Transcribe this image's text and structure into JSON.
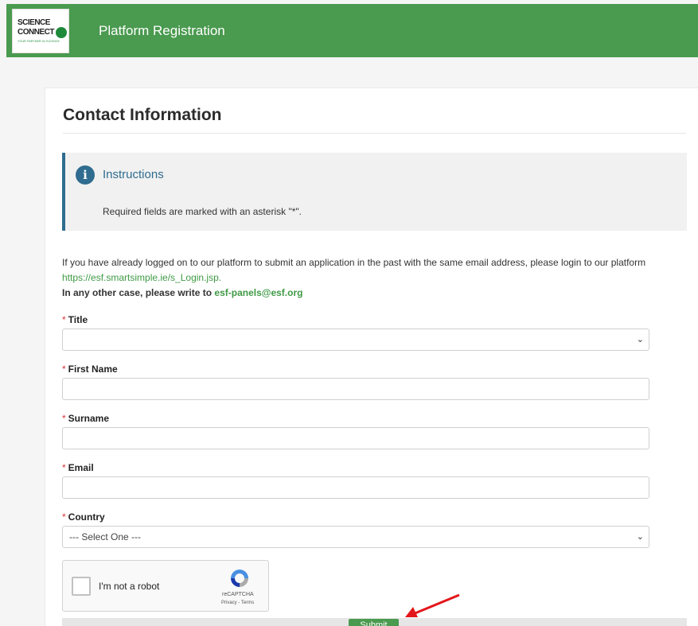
{
  "header": {
    "logo_line1": "SCIENCE",
    "logo_line2": "CONNECT",
    "logo_tagline": "YOUR PARTNER IN SCIENCE",
    "title": "Platform Registration",
    "color": "#4a9a4f"
  },
  "page": {
    "title": "Contact Information"
  },
  "instructions": {
    "icon": "info-icon",
    "title": "Instructions",
    "text": "Required fields are marked with an asterisk \"*\"."
  },
  "intro": {
    "line1": "If you have already logged on to our platform to submit an application in the past with the same email address, please login to our platform",
    "link": "https://esf.smartsimple.ie/s_Login.jsp.",
    "line3_prefix": "In any other case, please write to ",
    "email": "esf-panels@esf.org"
  },
  "form": {
    "title_label": "Title",
    "title_value": "",
    "first_name_label": "First Name",
    "first_name_value": "",
    "surname_label": "Surname",
    "surname_value": "",
    "email_label": "Email",
    "email_value": "",
    "country_label": "Country",
    "country_value": "--- Select One ---",
    "required_mark": "*"
  },
  "captcha": {
    "label": "I'm not a robot",
    "brand": "reCAPTCHA",
    "links": "Privacy - Terms"
  },
  "submit": {
    "label": "Submit"
  }
}
